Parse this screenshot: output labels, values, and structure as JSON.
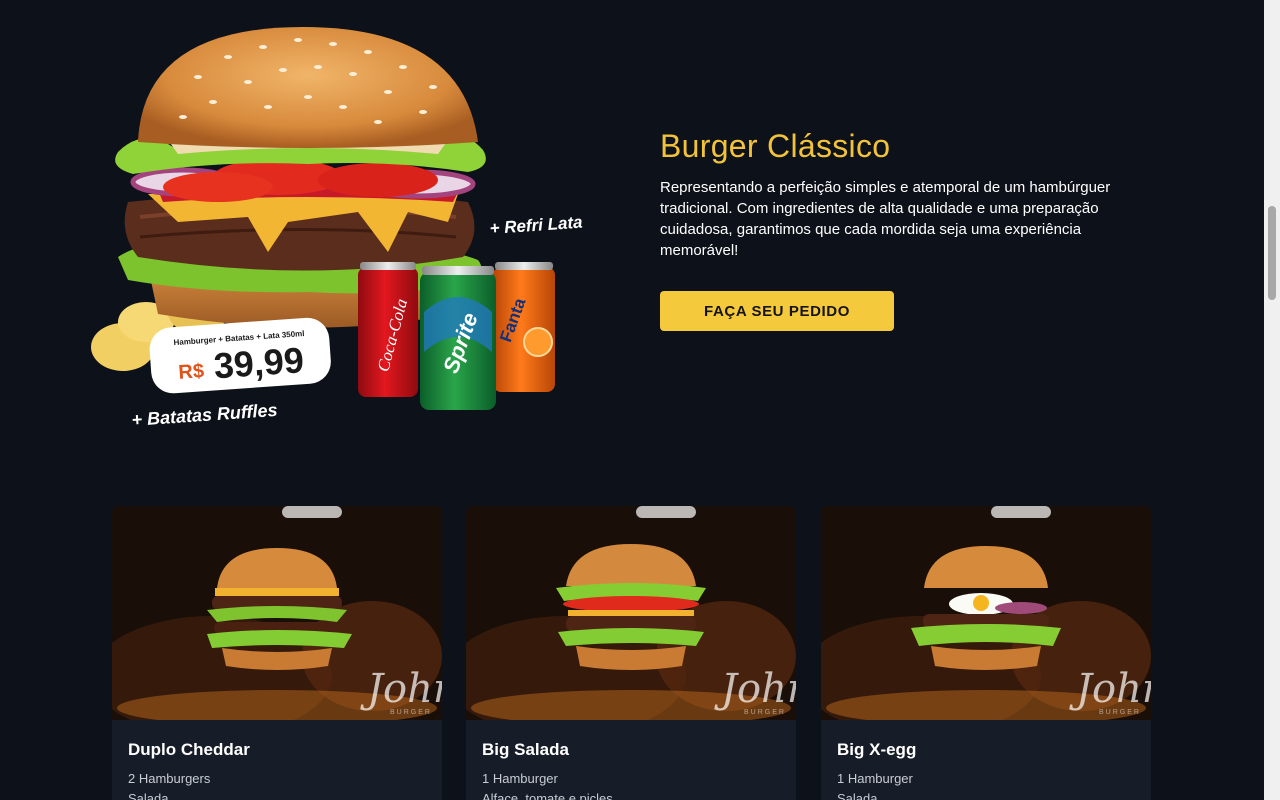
{
  "hero": {
    "title": "Burger Clássico",
    "description": "Representando a perfeição simples e atemporal de um hambúrguer tradicional. Com ingredientes de alta qualidade e uma preparação cuidadosa, garantimos que cada mordida seja uma experiência memorável!",
    "cta_label": "FAÇA SEU PEDIDO",
    "promo": {
      "refri_label": "+ Refri Lata",
      "combo_label": "Hamburger + Batatas + Lata 350ml",
      "currency": "R$",
      "price": "39,99",
      "batatas_label": "+ Batatas Ruffles",
      "cans": [
        "Coca-Cola",
        "Sprite",
        "Fanta"
      ]
    }
  },
  "cards": [
    {
      "title": "Duplo Cheddar",
      "line1": "2 Hamburgers",
      "line2": "Salada",
      "watermark": "John",
      "watermark_sub": "BURGER"
    },
    {
      "title": "Big Salada",
      "line1": "1 Hamburger",
      "line2": "Alface, tomate e picles",
      "watermark": "John",
      "watermark_sub": "BURGER"
    },
    {
      "title": "Big X-egg",
      "line1": "1 Hamburger",
      "line2": "Salada",
      "watermark": "John",
      "watermark_sub": "BURGER"
    }
  ],
  "colors": {
    "background": "#0d111a",
    "accent": "#f2c33a",
    "button": "#f5c93c",
    "card": "#161c28"
  }
}
